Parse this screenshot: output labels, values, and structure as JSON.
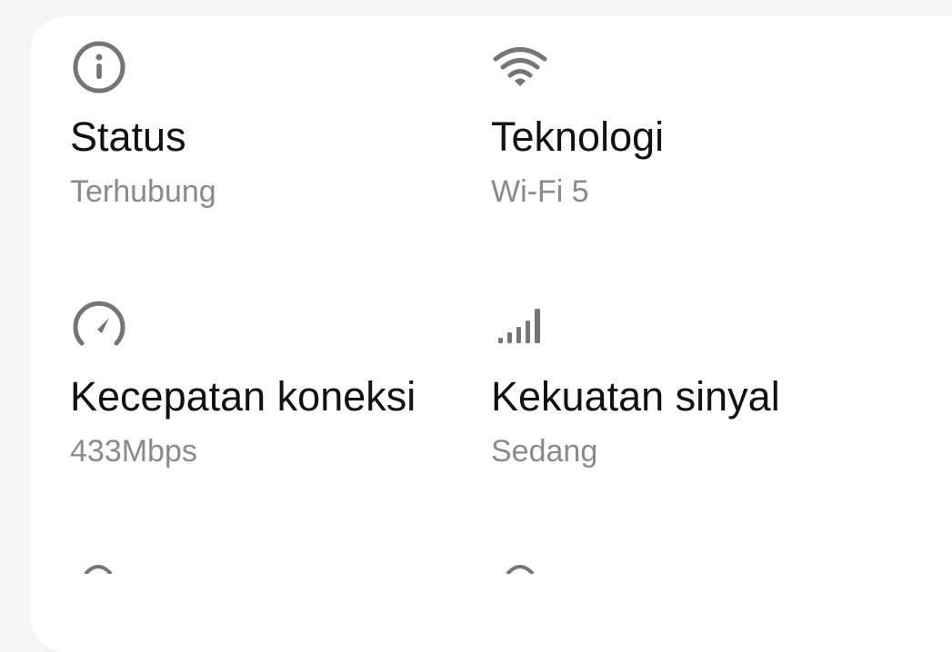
{
  "details": {
    "items": [
      {
        "icon": "info-icon",
        "title": "Status",
        "value": "Terhubung"
      },
      {
        "icon": "wifi-icon",
        "title": "Teknologi",
        "value": "Wi-Fi 5"
      },
      {
        "icon": "speedometer-icon",
        "title": "Kecepatan koneksi",
        "value": "433Mbps"
      },
      {
        "icon": "signal-strength-icon",
        "title": "Kekuatan sinyal",
        "value": "Sedang"
      }
    ]
  },
  "colors": {
    "background": "#f5f5f5",
    "card": "#ffffff",
    "title_text": "#111111",
    "value_text": "#8a8a8a",
    "icon": "#757575"
  }
}
